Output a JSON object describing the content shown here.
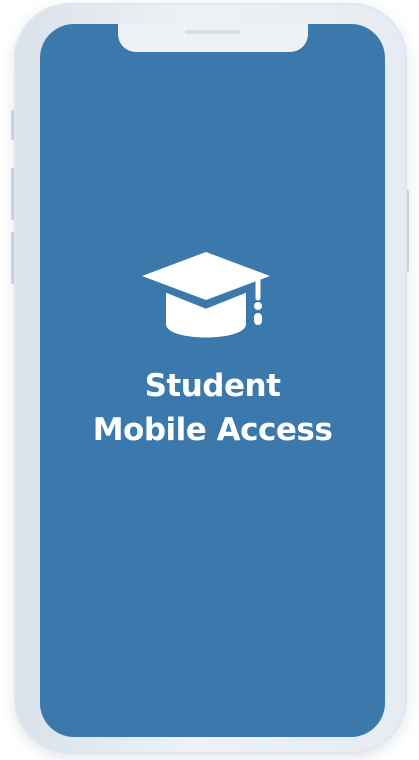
{
  "app": {
    "title_line1": "Student",
    "title_line2": "Mobile Access",
    "logo_icon": "graduation-cap-icon"
  },
  "colors": {
    "screen_background": "#3b78ab",
    "text": "#ffffff",
    "frame": "#eef2f6"
  }
}
